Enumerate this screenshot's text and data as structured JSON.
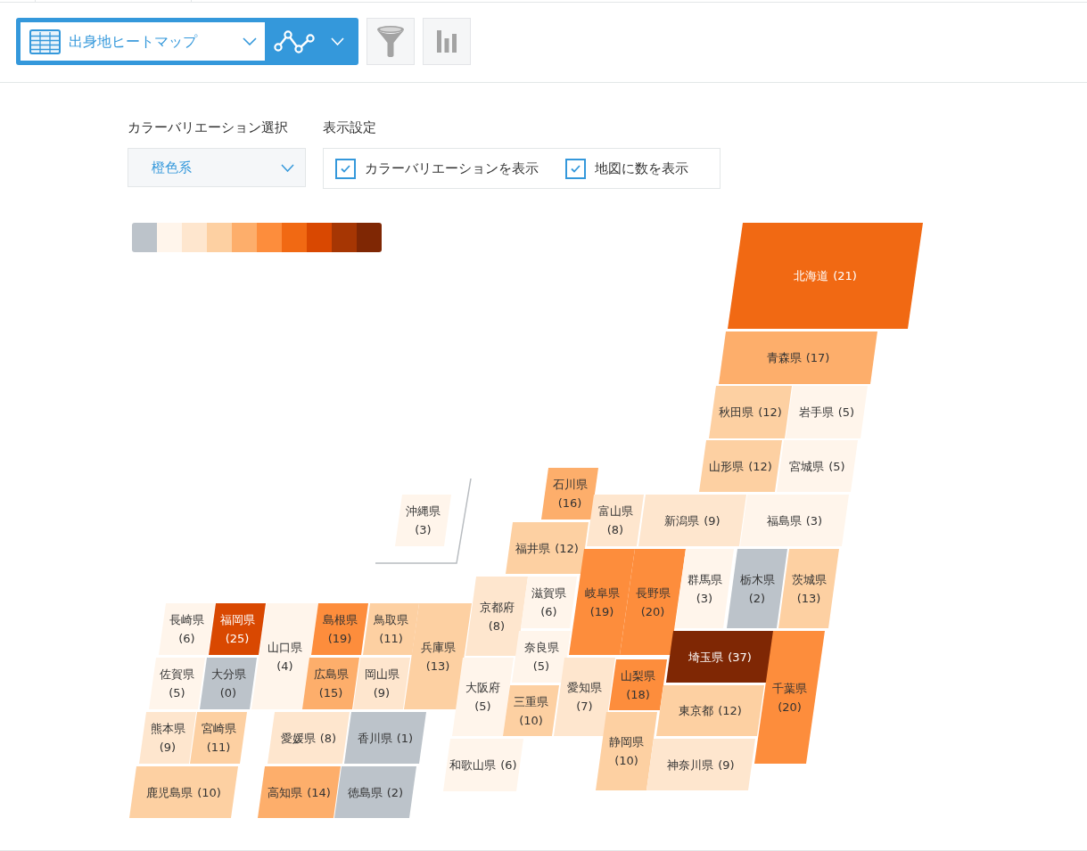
{
  "toolbar": {
    "report_select": {
      "label": "出身地ヒートマップ"
    }
  },
  "settings": {
    "color_variation": {
      "label": "カラーバリエーション選択",
      "value": "橙色系"
    },
    "display": {
      "label": "表示設定",
      "options": [
        {
          "label": "カラーバリエーションを表示",
          "checked": true
        },
        {
          "label": "地図に数を表示",
          "checked": true
        }
      ]
    }
  },
  "map": {
    "color_scale": [
      {
        "color": "#bcc3ca"
      },
      {
        "color": "#fff5eb"
      },
      {
        "color": "#fee6ce"
      },
      {
        "color": "#fdd0a2"
      },
      {
        "color": "#fdae6b"
      },
      {
        "color": "#fd8d3c"
      },
      {
        "color": "#f16913"
      },
      {
        "color": "#d94801"
      },
      {
        "color": "#a63603"
      },
      {
        "color": "#7f2704"
      }
    ],
    "prefectures": [
      {
        "name": "北海道",
        "count": "(21)",
        "color": "#f16913"
      },
      {
        "name": "青森県",
        "count": "(17)",
        "color": "#fdae6b"
      },
      {
        "name": "秋田県",
        "count": "(12)",
        "color": "#fdd0a2"
      },
      {
        "name": "岩手県",
        "count": "(5)",
        "color": "#fff5eb"
      },
      {
        "name": "山形県",
        "count": "(12)",
        "color": "#fdd0a2"
      },
      {
        "name": "宮城県",
        "count": "(5)",
        "color": "#fff5eb"
      },
      {
        "name": "石川県",
        "count": "(16)",
        "color": "#fdae6b"
      },
      {
        "name": "沖縄県",
        "count": "(3)",
        "color": "#fff5eb"
      },
      {
        "name": "富山県",
        "count": "(8)",
        "color": "#fee6ce"
      },
      {
        "name": "新潟県",
        "count": "(9)",
        "color": "#fee6ce"
      },
      {
        "name": "福島県",
        "count": "(3)",
        "color": "#fff5eb"
      },
      {
        "name": "福井県",
        "count": "(12)",
        "color": "#fdd0a2"
      },
      {
        "name": "岐阜県",
        "count": "(19)",
        "color": "#fd8d3c"
      },
      {
        "name": "長野県",
        "count": "(20)",
        "color": "#fd8d3c"
      },
      {
        "name": "群馬県",
        "count": "(3)",
        "color": "#fff5eb"
      },
      {
        "name": "栃木県",
        "count": "(2)",
        "color": "#bcc3ca"
      },
      {
        "name": "茨城県",
        "count": "(13)",
        "color": "#fdd0a2"
      },
      {
        "name": "京都府",
        "count": "(8)",
        "color": "#fee6ce"
      },
      {
        "name": "滋賀県",
        "count": "(6)",
        "color": "#fff5eb"
      },
      {
        "name": "長崎県",
        "count": "(6)",
        "color": "#fff5eb"
      },
      {
        "name": "福岡県",
        "count": "(25)",
        "color": "#d94801"
      },
      {
        "name": "山口県",
        "count": "(4)",
        "color": "#fff5eb"
      },
      {
        "name": "島根県",
        "count": "(19)",
        "color": "#fd8d3c"
      },
      {
        "name": "鳥取県",
        "count": "(11)",
        "color": "#fdd0a2"
      },
      {
        "name": "兵庫県",
        "count": "(13)",
        "color": "#fdd0a2"
      },
      {
        "name": "奈良県",
        "count": "(5)",
        "color": "#fff5eb"
      },
      {
        "name": "埼玉県",
        "count": "(37)",
        "color": "#7f2704"
      },
      {
        "name": "千葉県",
        "count": "(20)",
        "color": "#fd8d3c"
      },
      {
        "name": "佐賀県",
        "count": "(5)",
        "color": "#fff5eb"
      },
      {
        "name": "大分県",
        "count": "(0)",
        "color": "#bcc3ca"
      },
      {
        "name": "広島県",
        "count": "(15)",
        "color": "#fdae6b"
      },
      {
        "name": "岡山県",
        "count": "(9)",
        "color": "#fee6ce"
      },
      {
        "name": "大阪府",
        "count": "(5)",
        "color": "#fff5eb"
      },
      {
        "name": "愛知県",
        "count": "(7)",
        "color": "#fee6ce"
      },
      {
        "name": "山梨県",
        "count": "(18)",
        "color": "#fd8d3c"
      },
      {
        "name": "三重県",
        "count": "(10)",
        "color": "#fdd0a2"
      },
      {
        "name": "東京都",
        "count": "(12)",
        "color": "#fdd0a2"
      },
      {
        "name": "熊本県",
        "count": "(9)",
        "color": "#fee6ce"
      },
      {
        "name": "宮崎県",
        "count": "(11)",
        "color": "#fdd0a2"
      },
      {
        "name": "愛媛県",
        "count": "(8)",
        "color": "#fee6ce"
      },
      {
        "name": "香川県",
        "count": "(1)",
        "color": "#bcc3ca"
      },
      {
        "name": "静岡県",
        "count": "(10)",
        "color": "#fdd0a2"
      },
      {
        "name": "和歌山県",
        "count": "(6)",
        "color": "#fff5eb"
      },
      {
        "name": "神奈川県",
        "count": "(9)",
        "color": "#fee6ce"
      },
      {
        "name": "鹿児島県",
        "count": "(10)",
        "color": "#fdd0a2"
      },
      {
        "name": "高知県",
        "count": "(14)",
        "color": "#fdae6b"
      },
      {
        "name": "徳島県",
        "count": "(2)",
        "color": "#bcc3ca"
      }
    ]
  }
}
